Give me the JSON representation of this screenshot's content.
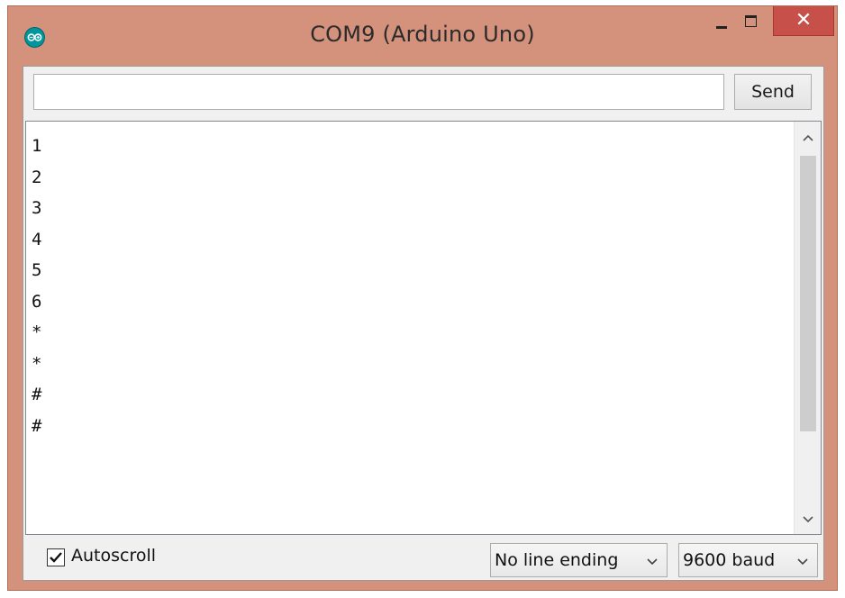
{
  "window": {
    "title": "COM9 (Arduino Uno)",
    "close_label": "✕"
  },
  "send": {
    "input_value": "",
    "button_label": "Send"
  },
  "monitor": {
    "lines": [
      "1",
      "2",
      "3",
      "4",
      "5",
      "6",
      "*",
      "*",
      "#",
      "#"
    ]
  },
  "footer": {
    "autoscroll_label": "Autoscroll",
    "autoscroll_checked": true,
    "line_ending": "No line ending",
    "baud_rate": "9600 baud"
  },
  "icons": {
    "app": "arduino-logo-icon",
    "minimize": "minimize-icon",
    "maximize": "maximize-icon",
    "close": "close-icon",
    "scroll_up": "chevron-up-icon",
    "scroll_down": "chevron-down-icon",
    "dropdown": "chevron-down-icon",
    "checkbox": "checkmark-icon"
  },
  "colors": {
    "window_frame": "#d4917c",
    "close_button": "#c7504a",
    "app_icon": "#00979c"
  }
}
